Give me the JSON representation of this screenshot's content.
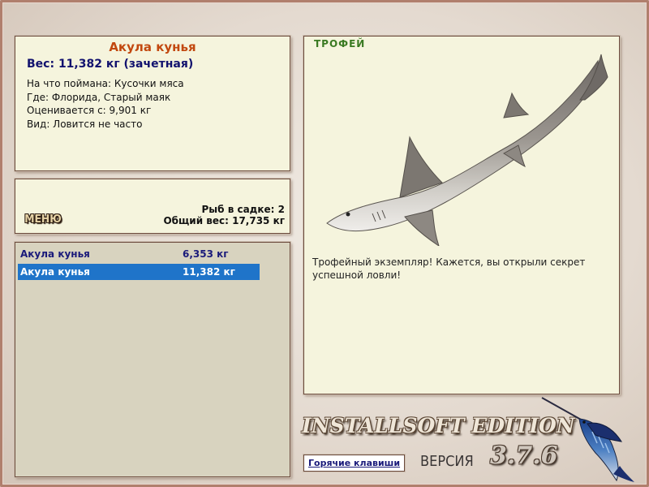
{
  "info": {
    "fish_name": "Акула кунья",
    "weight_line": "Вес: 11,382 кг (зачетная)",
    "lines": [
      "На что поймана: Кусочки мяса",
      "Где: Флорида, Старый маяк",
      "Оценивается с: 9,901 кг",
      "Вид: Ловится не часто"
    ]
  },
  "summary": {
    "menu_label": "МЕНЮ",
    "fish_count": "Рыб в садке: 2",
    "total_weight": "Общий вес: 17,735 кг"
  },
  "catch_list": [
    {
      "name": "Акула кунья",
      "weight": "6,353 кг",
      "selected": false
    },
    {
      "name": "Акула кунья",
      "weight": "11,382 кг",
      "selected": true
    }
  ],
  "trophy": {
    "label": "ТРОФЕЙ",
    "description": "Трофейный экземпляр! Кажется, вы открыли секрет успешной ловли!"
  },
  "branding": {
    "edition": "INSTALLSOFT EDITION",
    "version_label": "ВЕРСИЯ",
    "version": "3.7.6"
  },
  "hotkeys_label": "Горячие клавиши",
  "icons": {
    "trophy_image": "shark-image",
    "logo": "marlin-icon"
  },
  "colors": {
    "panel_bg": "#f5f4dd",
    "title_orange": "#c2480f",
    "text_navy": "#12126e",
    "selected_row": "#1f74c9",
    "trophy_green": "#3a7a22"
  }
}
